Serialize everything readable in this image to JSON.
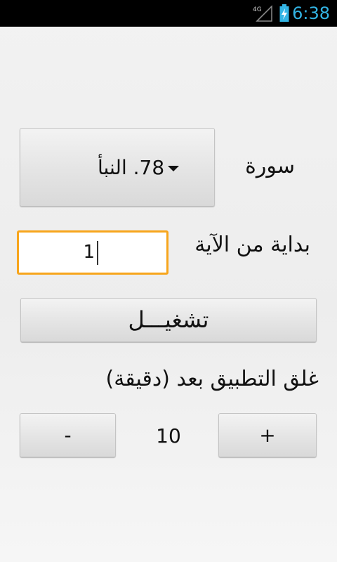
{
  "status_bar": {
    "network": "4G",
    "time": "6:38",
    "accent_color": "#33b5e5"
  },
  "surah": {
    "label": "سورة",
    "selected": "78. النبأ"
  },
  "start_ayah": {
    "label": "بداية من الآية",
    "value": "1"
  },
  "play_button": {
    "label": "تشغيـــل"
  },
  "close_app": {
    "label": "غلق التطبيق بعد (دقيقة)",
    "minutes": "10",
    "minus_label": "-",
    "plus_label": "+"
  },
  "focus_color": "#f7a51c"
}
